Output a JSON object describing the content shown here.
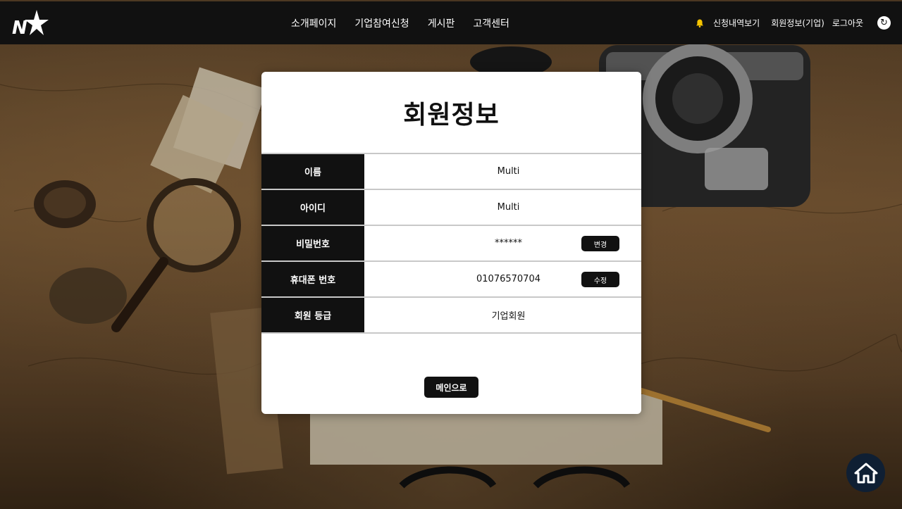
{
  "nav": {
    "brand_logo": "N-star-logo",
    "links": [
      "소개페이지",
      "기업참여신청",
      "게시판",
      "고객센터"
    ],
    "utility": {
      "bell_icon": "bell-icon",
      "applications": "신청내역보기",
      "member_info": "회원정보(기업)",
      "logout": "로그아웃",
      "refresh_icon": "refresh-icon",
      "refresh_glyph": "↻"
    }
  },
  "card": {
    "title": "회원정보",
    "rows": [
      {
        "label": "이름",
        "value": "Multi"
      },
      {
        "label": "아이디",
        "value": "Multi"
      },
      {
        "label": "비밀번호",
        "value": "******",
        "action": "변경"
      },
      {
        "label": "휴대폰 번호",
        "value": "01076570704",
        "action": "수정"
      },
      {
        "label": "회원 등급",
        "value": "기업회원"
      }
    ],
    "main_button": "메인으로"
  },
  "floating": {
    "home_icon": "home-icon"
  },
  "colors": {
    "nav_bg": "#111111",
    "label_bg": "#111111",
    "bell": "#f5c400",
    "home_button_bg": "#0f1f33"
  }
}
